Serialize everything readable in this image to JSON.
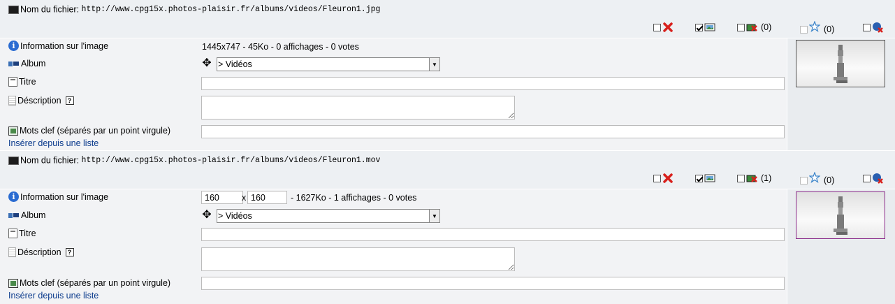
{
  "labels": {
    "filename": "Nom du fichier:",
    "info": "Information sur l'image",
    "album": "Album",
    "title": "Titre",
    "description": "Déscription",
    "keywords": "Mots clef (séparés par un point virgule)",
    "insert_from_list": "Insérer depuis une liste"
  },
  "files": [
    {
      "path": "http://www.cpg15x.photos-plaisir.fr/albums/videos/Fleuron1.jpg",
      "info_text": "1445x747 - 45Ko - 0 affichages - 0 votes",
      "album": "> Vidéos",
      "title": "",
      "description": "",
      "keywords": "",
      "count_reset": "(0)",
      "count_fav": "(0)"
    },
    {
      "path": "http://www.cpg15x.photos-plaisir.fr/albums/videos/Fleuron1.mov",
      "width": "160",
      "x_sep": "x",
      "height": "160",
      "info_text": "- 1627Ko - 1 affichages - 0 votes",
      "album": "> Vidéos",
      "title": "",
      "description": "",
      "keywords": "",
      "count_reset": "(1)",
      "count_fav": "(0)"
    }
  ],
  "icons": {
    "delete": "delete-icon",
    "approve": "approve-icon",
    "reset": "reset-views-icon",
    "favorite": "favorite-star-icon",
    "reset_votes": "reset-votes-icon",
    "move": "move-icon"
  },
  "colors": {
    "link": "#0a3a8c",
    "header_bg": "#edf0f3",
    "delete_red": "#d8201c"
  }
}
